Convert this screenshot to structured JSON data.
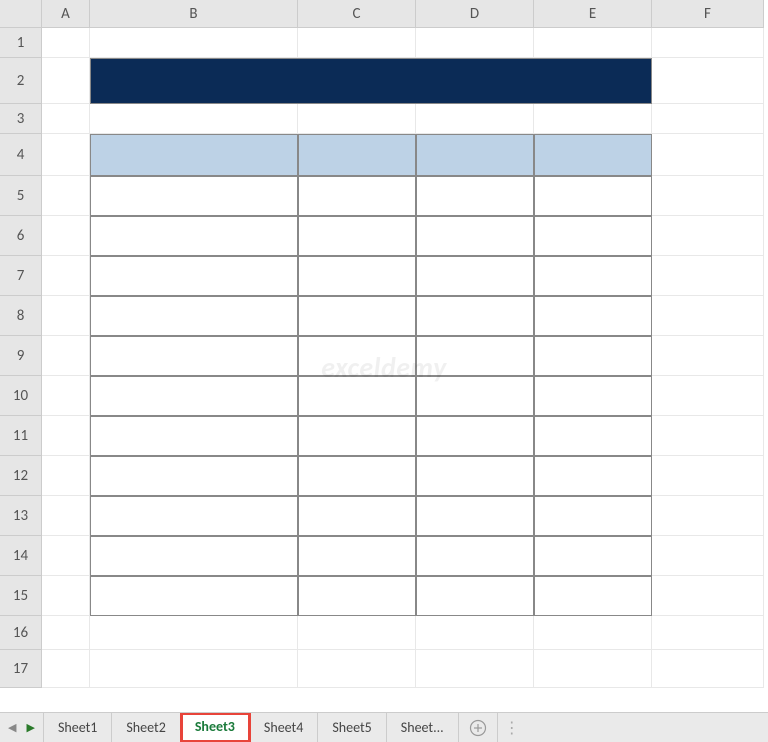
{
  "columns": [
    "A",
    "B",
    "C",
    "D",
    "E",
    "F"
  ],
  "rows": [
    "1",
    "2",
    "3",
    "4",
    "5",
    "6",
    "7",
    "8",
    "9",
    "10",
    "11",
    "12",
    "13",
    "14",
    "15",
    "16",
    "17"
  ],
  "tabs": {
    "items": [
      {
        "label": "Sheet1"
      },
      {
        "label": "Sheet2"
      },
      {
        "label": "Sheet3"
      },
      {
        "label": "Sheet4"
      },
      {
        "label": "Sheet5"
      },
      {
        "label": "Sheet..."
      }
    ],
    "active_index": 2
  },
  "watermark": "exceldemy"
}
